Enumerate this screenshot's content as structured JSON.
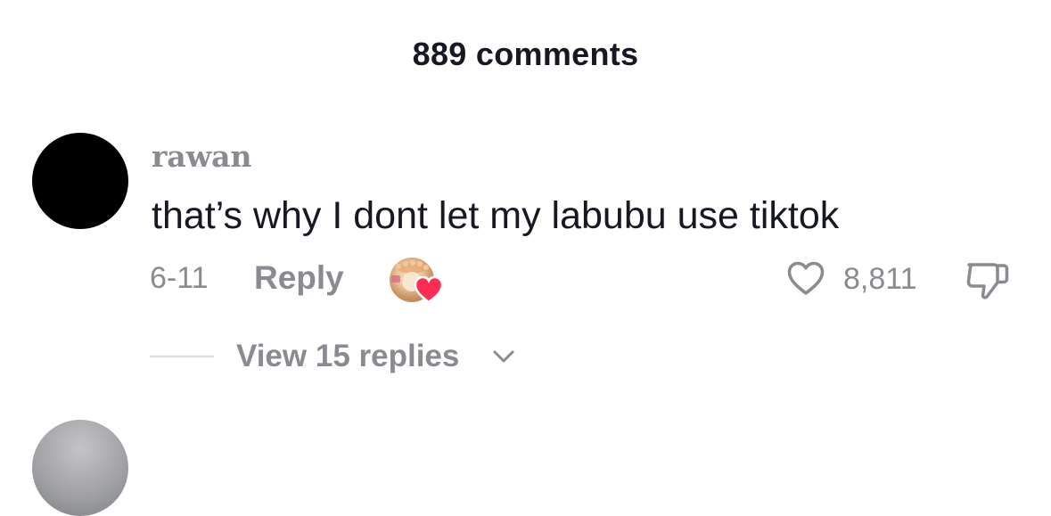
{
  "header": {
    "title": "889 comments"
  },
  "comment": {
    "username": "rawan",
    "text": "that’s why I dont let my labubu use tiktok",
    "date": "6-11",
    "reply_label": "Reply",
    "like_count": "8,811",
    "view_replies_label": "View 15 replies"
  },
  "colors": {
    "text_primary": "#161823",
    "text_secondary": "#8a8b91",
    "heart_red": "#fe2c55"
  },
  "icons": {
    "like": "heart-outline-icon",
    "dislike": "thumbs-down-icon",
    "creator_liked": "heart-filled-icon",
    "expand": "chevron-down-icon"
  }
}
